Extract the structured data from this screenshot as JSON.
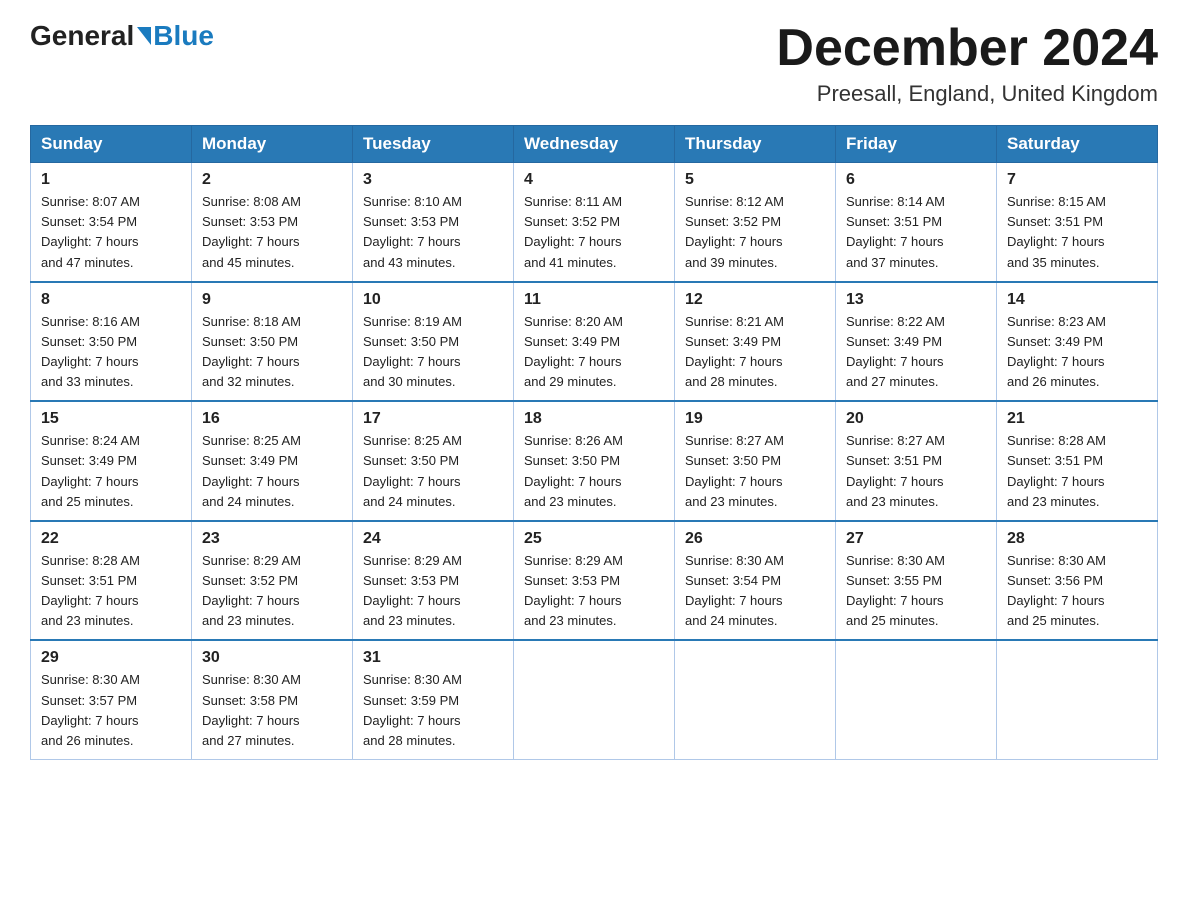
{
  "logo": {
    "general": "General",
    "blue": "Blue"
  },
  "title": "December 2024",
  "location": "Preesall, England, United Kingdom",
  "headers": [
    "Sunday",
    "Monday",
    "Tuesday",
    "Wednesday",
    "Thursday",
    "Friday",
    "Saturday"
  ],
  "weeks": [
    [
      {
        "day": "1",
        "sunrise": "8:07 AM",
        "sunset": "3:54 PM",
        "daylight": "7 hours and 47 minutes."
      },
      {
        "day": "2",
        "sunrise": "8:08 AM",
        "sunset": "3:53 PM",
        "daylight": "7 hours and 45 minutes."
      },
      {
        "day": "3",
        "sunrise": "8:10 AM",
        "sunset": "3:53 PM",
        "daylight": "7 hours and 43 minutes."
      },
      {
        "day": "4",
        "sunrise": "8:11 AM",
        "sunset": "3:52 PM",
        "daylight": "7 hours and 41 minutes."
      },
      {
        "day": "5",
        "sunrise": "8:12 AM",
        "sunset": "3:52 PM",
        "daylight": "7 hours and 39 minutes."
      },
      {
        "day": "6",
        "sunrise": "8:14 AM",
        "sunset": "3:51 PM",
        "daylight": "7 hours and 37 minutes."
      },
      {
        "day": "7",
        "sunrise": "8:15 AM",
        "sunset": "3:51 PM",
        "daylight": "7 hours and 35 minutes."
      }
    ],
    [
      {
        "day": "8",
        "sunrise": "8:16 AM",
        "sunset": "3:50 PM",
        "daylight": "7 hours and 33 minutes."
      },
      {
        "day": "9",
        "sunrise": "8:18 AM",
        "sunset": "3:50 PM",
        "daylight": "7 hours and 32 minutes."
      },
      {
        "day": "10",
        "sunrise": "8:19 AM",
        "sunset": "3:50 PM",
        "daylight": "7 hours and 30 minutes."
      },
      {
        "day": "11",
        "sunrise": "8:20 AM",
        "sunset": "3:49 PM",
        "daylight": "7 hours and 29 minutes."
      },
      {
        "day": "12",
        "sunrise": "8:21 AM",
        "sunset": "3:49 PM",
        "daylight": "7 hours and 28 minutes."
      },
      {
        "day": "13",
        "sunrise": "8:22 AM",
        "sunset": "3:49 PM",
        "daylight": "7 hours and 27 minutes."
      },
      {
        "day": "14",
        "sunrise": "8:23 AM",
        "sunset": "3:49 PM",
        "daylight": "7 hours and 26 minutes."
      }
    ],
    [
      {
        "day": "15",
        "sunrise": "8:24 AM",
        "sunset": "3:49 PM",
        "daylight": "7 hours and 25 minutes."
      },
      {
        "day": "16",
        "sunrise": "8:25 AM",
        "sunset": "3:49 PM",
        "daylight": "7 hours and 24 minutes."
      },
      {
        "day": "17",
        "sunrise": "8:25 AM",
        "sunset": "3:50 PM",
        "daylight": "7 hours and 24 minutes."
      },
      {
        "day": "18",
        "sunrise": "8:26 AM",
        "sunset": "3:50 PM",
        "daylight": "7 hours and 23 minutes."
      },
      {
        "day": "19",
        "sunrise": "8:27 AM",
        "sunset": "3:50 PM",
        "daylight": "7 hours and 23 minutes."
      },
      {
        "day": "20",
        "sunrise": "8:27 AM",
        "sunset": "3:51 PM",
        "daylight": "7 hours and 23 minutes."
      },
      {
        "day": "21",
        "sunrise": "8:28 AM",
        "sunset": "3:51 PM",
        "daylight": "7 hours and 23 minutes."
      }
    ],
    [
      {
        "day": "22",
        "sunrise": "8:28 AM",
        "sunset": "3:51 PM",
        "daylight": "7 hours and 23 minutes."
      },
      {
        "day": "23",
        "sunrise": "8:29 AM",
        "sunset": "3:52 PM",
        "daylight": "7 hours and 23 minutes."
      },
      {
        "day": "24",
        "sunrise": "8:29 AM",
        "sunset": "3:53 PM",
        "daylight": "7 hours and 23 minutes."
      },
      {
        "day": "25",
        "sunrise": "8:29 AM",
        "sunset": "3:53 PM",
        "daylight": "7 hours and 23 minutes."
      },
      {
        "day": "26",
        "sunrise": "8:30 AM",
        "sunset": "3:54 PM",
        "daylight": "7 hours and 24 minutes."
      },
      {
        "day": "27",
        "sunrise": "8:30 AM",
        "sunset": "3:55 PM",
        "daylight": "7 hours and 25 minutes."
      },
      {
        "day": "28",
        "sunrise": "8:30 AM",
        "sunset": "3:56 PM",
        "daylight": "7 hours and 25 minutes."
      }
    ],
    [
      {
        "day": "29",
        "sunrise": "8:30 AM",
        "sunset": "3:57 PM",
        "daylight": "7 hours and 26 minutes."
      },
      {
        "day": "30",
        "sunrise": "8:30 AM",
        "sunset": "3:58 PM",
        "daylight": "7 hours and 27 minutes."
      },
      {
        "day": "31",
        "sunrise": "8:30 AM",
        "sunset": "3:59 PM",
        "daylight": "7 hours and 28 minutes."
      },
      null,
      null,
      null,
      null
    ]
  ]
}
